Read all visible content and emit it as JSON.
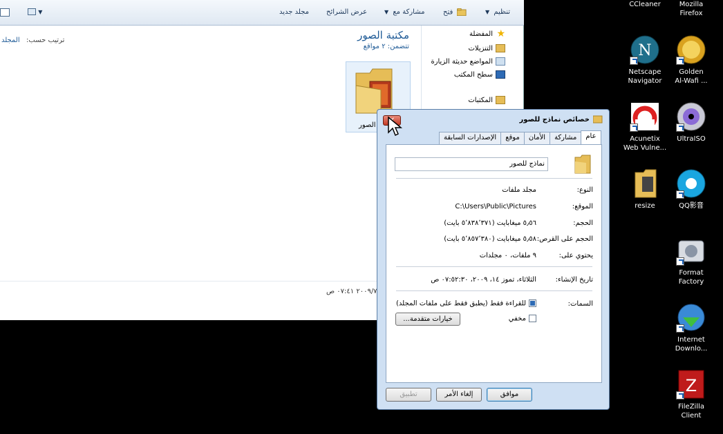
{
  "explorer": {
    "toolbar": {
      "organize": "تنظيم",
      "open": "فتح",
      "share_with": "مشاركة مع",
      "slideshow": "عرض الشرائح",
      "new_folder": "مجلد جديد"
    },
    "nav": {
      "favorites": "المفضلة",
      "downloads": "التنزيلات",
      "recent_places": "المواضع حديثة الزيارة",
      "desktop": "سطح المكتب",
      "libraries": "المكتبات"
    },
    "library_title": "مكتبة الصور",
    "library_subtitle": "تتضمن: ٢ مواقع",
    "sort_by_label": "ترتيب حسب:",
    "sort_by_value": "المجلد",
    "folder_caption": "الصور",
    "date_text": "٢٠٠٩/٧ ٠٧:٤١ ص"
  },
  "desktop_icons": [
    {
      "label1": "CCleaner",
      "label2": ""
    },
    {
      "label1": "Mozilla",
      "label2": "Firefox"
    },
    {
      "label1": "Netscape",
      "label2": "Navigator"
    },
    {
      "label1": "Golden",
      "label2": "Al-Wafi ..."
    },
    {
      "label1": "Acunetix",
      "label2": "Web Vulne..."
    },
    {
      "label1": "UltraISO",
      "label2": ""
    },
    {
      "label1": "resize",
      "label2": ""
    },
    {
      "label1": "QQ影音",
      "label2": ""
    },
    {
      "label1": "Format",
      "label2": "Factory"
    },
    {
      "label1": "Internet",
      "label2": "Downlo..."
    },
    {
      "label1": "FileZilla",
      "label2": "Client"
    }
  ],
  "dialog": {
    "title": "خصائص نماذج للصور",
    "close_glyph": "✕",
    "tabs": [
      "عام",
      "مشاركة",
      "الأمان",
      "موقع",
      "الإصدارات السابقة"
    ],
    "folder_name": "نماذج للصور",
    "rows": {
      "type_label": "النوع:",
      "type_value": "مجلد ملفات",
      "location_label": "الموقع:",
      "location_value": "C:\\Users\\Public\\Pictures",
      "size_label": "الحجم:",
      "size_value": "٥٫٥٦ ميغابايت (٥٬٨٣٨٬٣٧١ بايت)",
      "size_disk_label": "الحجم على القرص:",
      "size_disk_value": "٥٫٥٨ ميغابايت (٥٬٨٥٧٬٣٨٠ بايت)",
      "contains_label": "يحتوي على:",
      "contains_value": "٩ ملفات، ٠ مجلدات",
      "created_label": "تاريخ الإنشاء:",
      "created_value": "الثلاثاء، تموز ١٤، ٢٠٠٩، ٠٧:٥٢:٣٠ ص",
      "attributes_label": "السمات:",
      "readonly_label": "للقراءة فقط (يطبق فقط على ملفات المجلد)",
      "hidden_label": "مخفي"
    },
    "advanced_button": "خيارات متقدمة...",
    "ok_button": "موافق",
    "cancel_button": "إلغاء الأمر",
    "apply_button": "تطبيق"
  },
  "colors": {
    "accent": "#1e5a96",
    "close_red": "#c43a24",
    "dialog_frame": "#cfe0f3"
  }
}
